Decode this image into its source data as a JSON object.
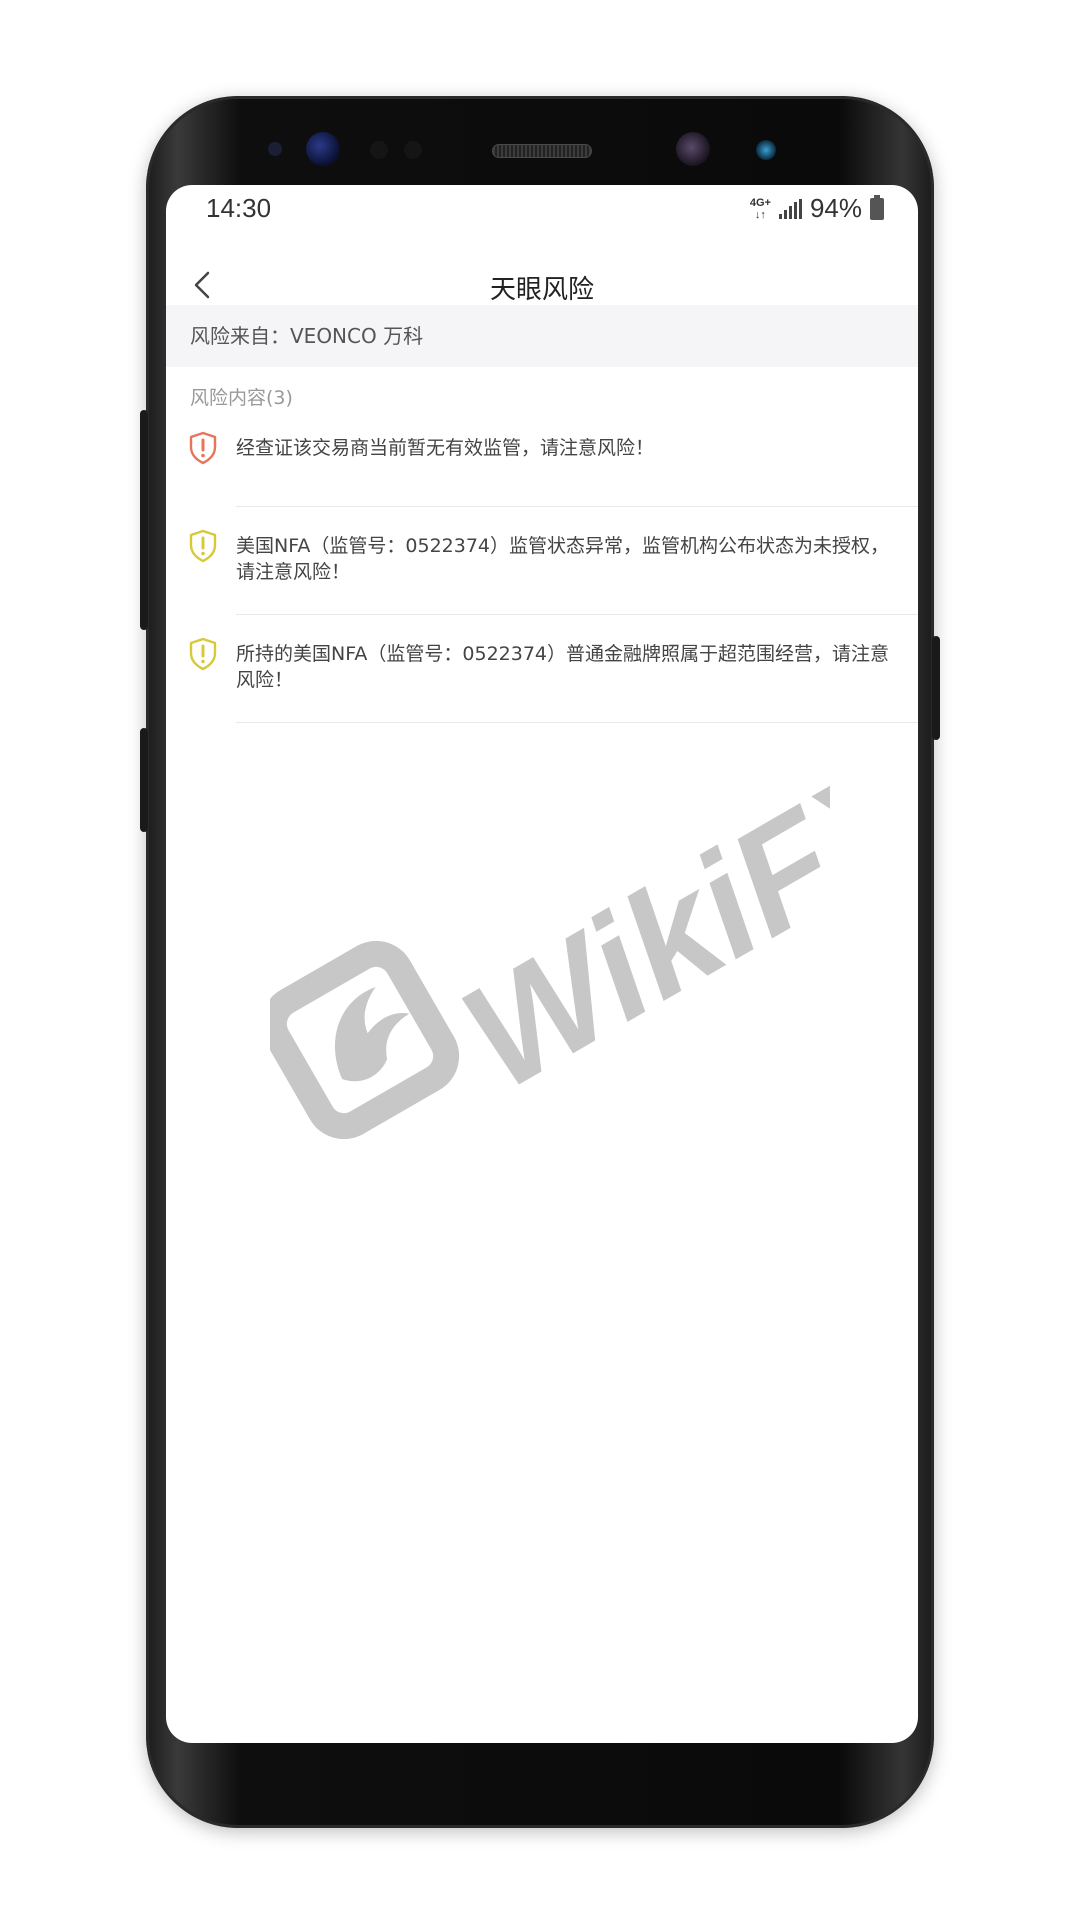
{
  "status_bar": {
    "time": "14:30",
    "network_type_top": "4G+",
    "network_type_bottom": "↓↑",
    "battery_percent": "94%"
  },
  "header": {
    "title": "天眼风险",
    "back_icon": "chevron-left-icon"
  },
  "source": {
    "text": "风险来自：VEONCO 万科"
  },
  "risk_section": {
    "title": "风险内容(3)",
    "items": [
      {
        "level": "high",
        "icon": "shield-alert-icon",
        "color": "#e8745a",
        "text": "经查证该交易商当前暂无有效监管，请注意风险！"
      },
      {
        "level": "medium",
        "icon": "shield-alert-icon",
        "color": "#d6c93a",
        "text": "美国NFA（监管号：0522374）监管状态异常，监管机构公布状态为未授权，请注意风险！"
      },
      {
        "level": "medium",
        "icon": "shield-alert-icon",
        "color": "#d6c93a",
        "text": "所持的美国NFA（监管号：0522374）普通金融牌照属于超范围经营，请注意风险！"
      }
    ]
  },
  "watermark": {
    "text": "WikiFX",
    "icon": "eagle-logo-icon"
  }
}
